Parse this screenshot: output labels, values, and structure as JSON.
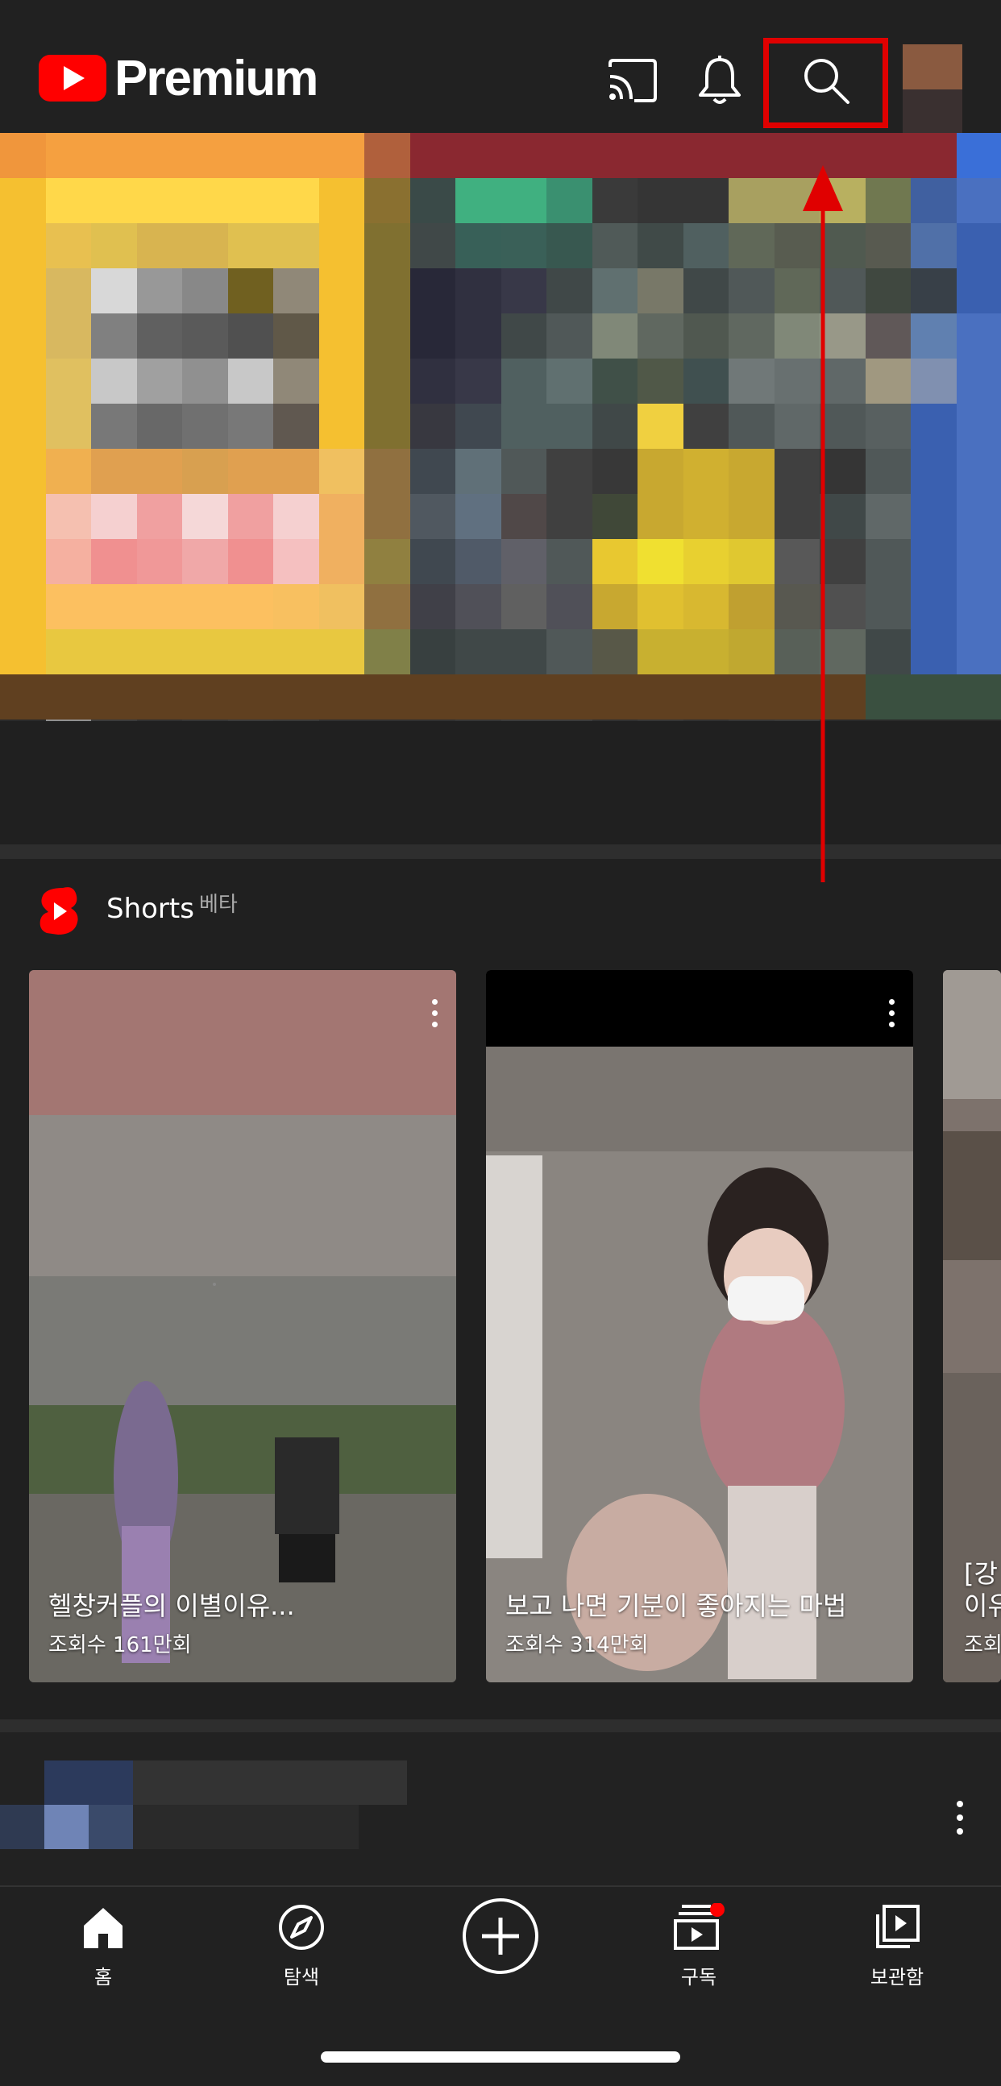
{
  "header": {
    "brand": "Premium",
    "icons": [
      "youtube-logo-icon",
      "cast-icon",
      "bell-icon",
      "search-icon",
      "avatar"
    ]
  },
  "shorts": {
    "title": "Shorts",
    "beta": "베타",
    "cards": [
      {
        "title": "헬창커플의 이별이유...",
        "views": "조회수 161만회"
      },
      {
        "title": "보고 나면 기분이 좋아지는 마법",
        "views": "조회수 314만회"
      },
      {
        "title": "[강",
        "title2": "이유",
        "views": "조회"
      }
    ]
  },
  "nav": {
    "items": [
      {
        "label": "홈",
        "icon": "home-icon"
      },
      {
        "label": "탐색",
        "icon": "compass-icon"
      },
      {
        "label": "",
        "icon": "add-circle-icon"
      },
      {
        "label": "구독",
        "icon": "subscriptions-icon"
      },
      {
        "label": "보관함",
        "icon": "library-icon"
      }
    ]
  },
  "colors": {
    "background": "#202020",
    "accent_red": "#ff0000",
    "annotation_red": "#e00000",
    "text": "#ffffff"
  }
}
